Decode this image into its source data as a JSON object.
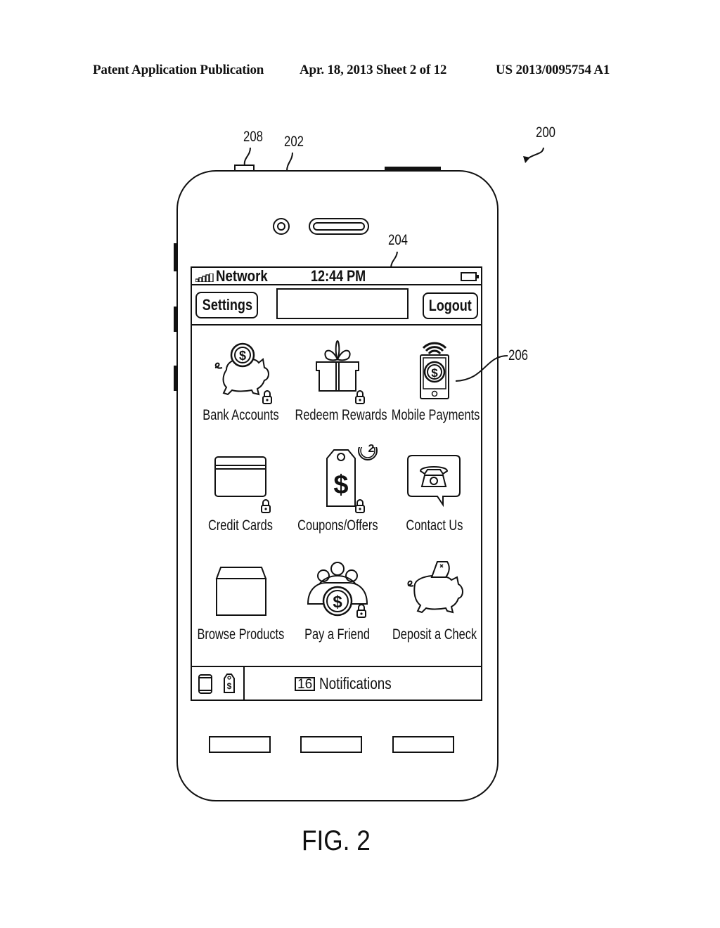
{
  "header": {
    "left": "Patent Application Publication",
    "center": "Apr. 18, 2013  Sheet 2 of 12",
    "right": "US 2013/0095754 A1"
  },
  "reference_numerals": {
    "device": "200",
    "housing": "202",
    "screen": "204",
    "icon": "206",
    "button": "208"
  },
  "phone": {
    "status_bar": {
      "signal_icon": "signal-bars-icon",
      "network": "Network",
      "time": "12:44 PM",
      "battery_icon": "battery-icon"
    },
    "nav": {
      "settings_label": "Settings",
      "search_value": "",
      "logout_label": "Logout"
    },
    "grid": [
      {
        "label": "Bank Accounts",
        "icon": "piggy-bank-coin-icon",
        "locked": true
      },
      {
        "label": "Redeem Rewards",
        "icon": "gift-icon",
        "locked": true
      },
      {
        "label": "Mobile Payments",
        "icon": "mobile-payment-icon",
        "locked": false
      },
      {
        "label": "Credit Cards",
        "icon": "credit-card-icon",
        "locked": true
      },
      {
        "label": "Coupons/Offers",
        "icon": "price-tag-icon",
        "locked": true,
        "badge": "2"
      },
      {
        "label": "Contact Us",
        "icon": "phone-speech-bubble-icon",
        "locked": false
      },
      {
        "label": "Browse Products",
        "icon": "box-icon",
        "locked": false
      },
      {
        "label": "Pay a Friend",
        "icon": "people-coin-icon",
        "locked": true
      },
      {
        "label": "Deposit a Check",
        "icon": "piggy-bank-check-icon",
        "locked": false
      }
    ],
    "bottom_bar": {
      "notification_count": "16",
      "notifications_label": "Notifications"
    }
  },
  "caption": "FIG. 2"
}
